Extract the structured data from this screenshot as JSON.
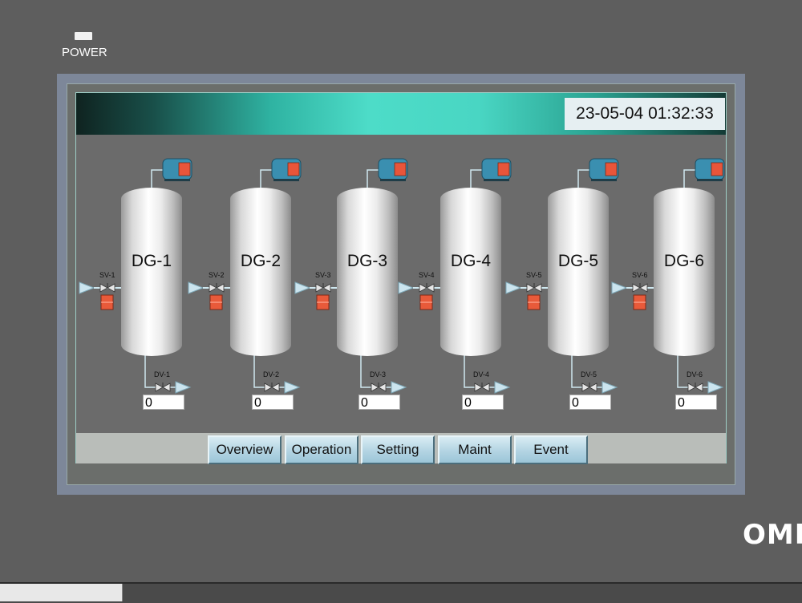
{
  "device": {
    "power_label": "POWER",
    "brand": "OMRON"
  },
  "header": {
    "datetime": "23-05-04 01:32:33"
  },
  "tanks": [
    {
      "name": "DG-1",
      "supply_valve": "SV-1",
      "drain_valve": "DV-1",
      "value": "0"
    },
    {
      "name": "DG-2",
      "supply_valve": "SV-2",
      "drain_valve": "DV-2",
      "value": "0"
    },
    {
      "name": "DG-3",
      "supply_valve": "SV-3",
      "drain_valve": "DV-3",
      "value": "0"
    },
    {
      "name": "DG-4",
      "supply_valve": "SV-4",
      "drain_valve": "DV-4",
      "value": "0"
    },
    {
      "name": "DG-5",
      "supply_valve": "SV-5",
      "drain_valve": "DV-5",
      "value": "0"
    },
    {
      "name": "DG-6",
      "supply_valve": "SV-6",
      "drain_valve": "DV-6",
      "value": "0"
    }
  ],
  "nav": {
    "buttons": [
      "Overview",
      "Operation",
      "Setting",
      "Maint",
      "Event"
    ]
  },
  "colors": {
    "header_accent": "#4ddcc8",
    "pipe": "#cfe8f0",
    "valve_indicator": "#e85a3a",
    "motor_body": "#3a8fb0"
  },
  "icons": {
    "motor": "motor-icon",
    "valve": "valve-icon",
    "flow_arrow": "flow-arrow-icon",
    "status_indicator": "status-indicator-icon"
  }
}
